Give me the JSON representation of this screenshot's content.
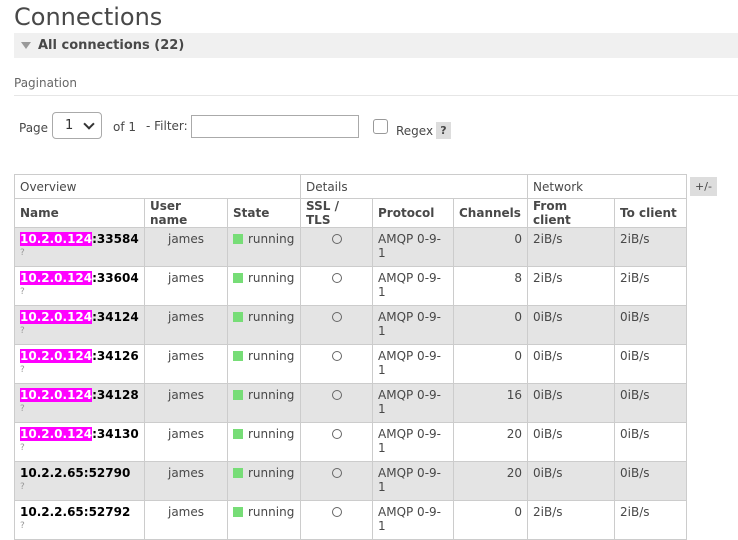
{
  "page": {
    "title": "Connections"
  },
  "section": {
    "header": "All connections (22)"
  },
  "pagination": {
    "title": "Pagination",
    "page_label": "Page",
    "page_value": "1",
    "of_label": "of 1",
    "filter_label": "- Filter:",
    "filter_value": "",
    "regex_label": "Regex",
    "help_label": "?"
  },
  "table": {
    "columns_toggle": "+/-",
    "groups": [
      "Overview",
      "Details",
      "Network"
    ],
    "headers": [
      "Name",
      "User name",
      "State",
      "SSL / TLS",
      "Protocol",
      "Channels",
      "From client",
      "To client"
    ],
    "rows": [
      {
        "name_hl": "10.2.0.124",
        "name_rest": ":33584",
        "sub": "?",
        "user": "james",
        "state": "running",
        "protocol": "AMQP 0-9-1",
        "channels": "0",
        "from": "2iB/s",
        "to": "2iB/s"
      },
      {
        "name_hl": "10.2.0.124",
        "name_rest": ":33604",
        "sub": "?",
        "user": "james",
        "state": "running",
        "protocol": "AMQP 0-9-1",
        "channels": "8",
        "from": "2iB/s",
        "to": "2iB/s"
      },
      {
        "name_hl": "10.2.0.124",
        "name_rest": ":34124",
        "sub": "?",
        "user": "james",
        "state": "running",
        "protocol": "AMQP 0-9-1",
        "channels": "0",
        "from": "0iB/s",
        "to": "0iB/s"
      },
      {
        "name_hl": "10.2.0.124",
        "name_rest": ":34126",
        "sub": "?",
        "user": "james",
        "state": "running",
        "protocol": "AMQP 0-9-1",
        "channels": "0",
        "from": "0iB/s",
        "to": "0iB/s"
      },
      {
        "name_hl": "10.2.0.124",
        "name_rest": ":34128",
        "sub": "?",
        "user": "james",
        "state": "running",
        "protocol": "AMQP 0-9-1",
        "channels": "16",
        "from": "0iB/s",
        "to": "0iB/s"
      },
      {
        "name_hl": "10.2.0.124",
        "name_rest": ":34130",
        "sub": "?",
        "user": "james",
        "state": "running",
        "protocol": "AMQP 0-9-1",
        "channels": "20",
        "from": "0iB/s",
        "to": "0iB/s"
      },
      {
        "name_hl": "",
        "name_rest": "10.2.2.65:52790",
        "sub": "?",
        "user": "james",
        "state": "running",
        "protocol": "AMQP 0-9-1",
        "channels": "20",
        "from": "0iB/s",
        "to": "0iB/s"
      },
      {
        "name_hl": "",
        "name_rest": "10.2.2.65:52792",
        "sub": "?",
        "user": "james",
        "state": "running",
        "protocol": "AMQP 0-9-1",
        "channels": "0",
        "from": "2iB/s",
        "to": "2iB/s"
      }
    ]
  },
  "icons": {
    "section_toggle": "triangle-down-icon",
    "page_select": "chevron-down-icon",
    "ssl": "circle-outline-icon",
    "state": "square-status-icon"
  },
  "colors": {
    "highlight": "#ff00ff",
    "running": "#77dd77",
    "odd_row": "#e4e4e4",
    "header_band": "#f0f0f0"
  }
}
